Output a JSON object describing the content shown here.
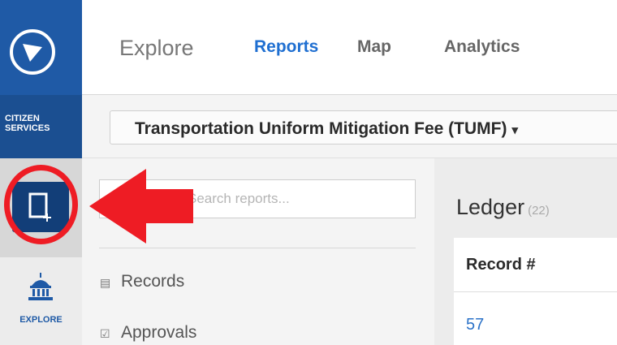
{
  "sidebar": {
    "brand_line1": "CITIZEN",
    "brand_line2": "SERVICES",
    "explore_label": "EXPLORE",
    "new_record_icon": "new-document-icon",
    "explore_icon": "government-building-icon"
  },
  "topnav": {
    "explore": "Explore",
    "reports": "Reports",
    "map": "Map",
    "analytics": "Analytics"
  },
  "dataset_selector": {
    "label": "Transportation Uniform Mitigation Fee (TUMF)",
    "caret": "▾"
  },
  "report_list": {
    "search_placeholder": "Search reports...",
    "items": [
      {
        "label": "Records",
        "icon": "grid-icon"
      },
      {
        "label": "Approvals",
        "icon": "checkbox-icon"
      }
    ]
  },
  "main": {
    "title": "Ledger",
    "count": "(22)",
    "table": {
      "columns": [
        "Record #"
      ],
      "rows": [
        [
          "57"
        ]
      ]
    }
  },
  "colors": {
    "brand_blue": "#1f5aa6",
    "active_button": "#123e78",
    "link_blue": "#1f6fd1",
    "annotation_red": "#ee1c24"
  }
}
